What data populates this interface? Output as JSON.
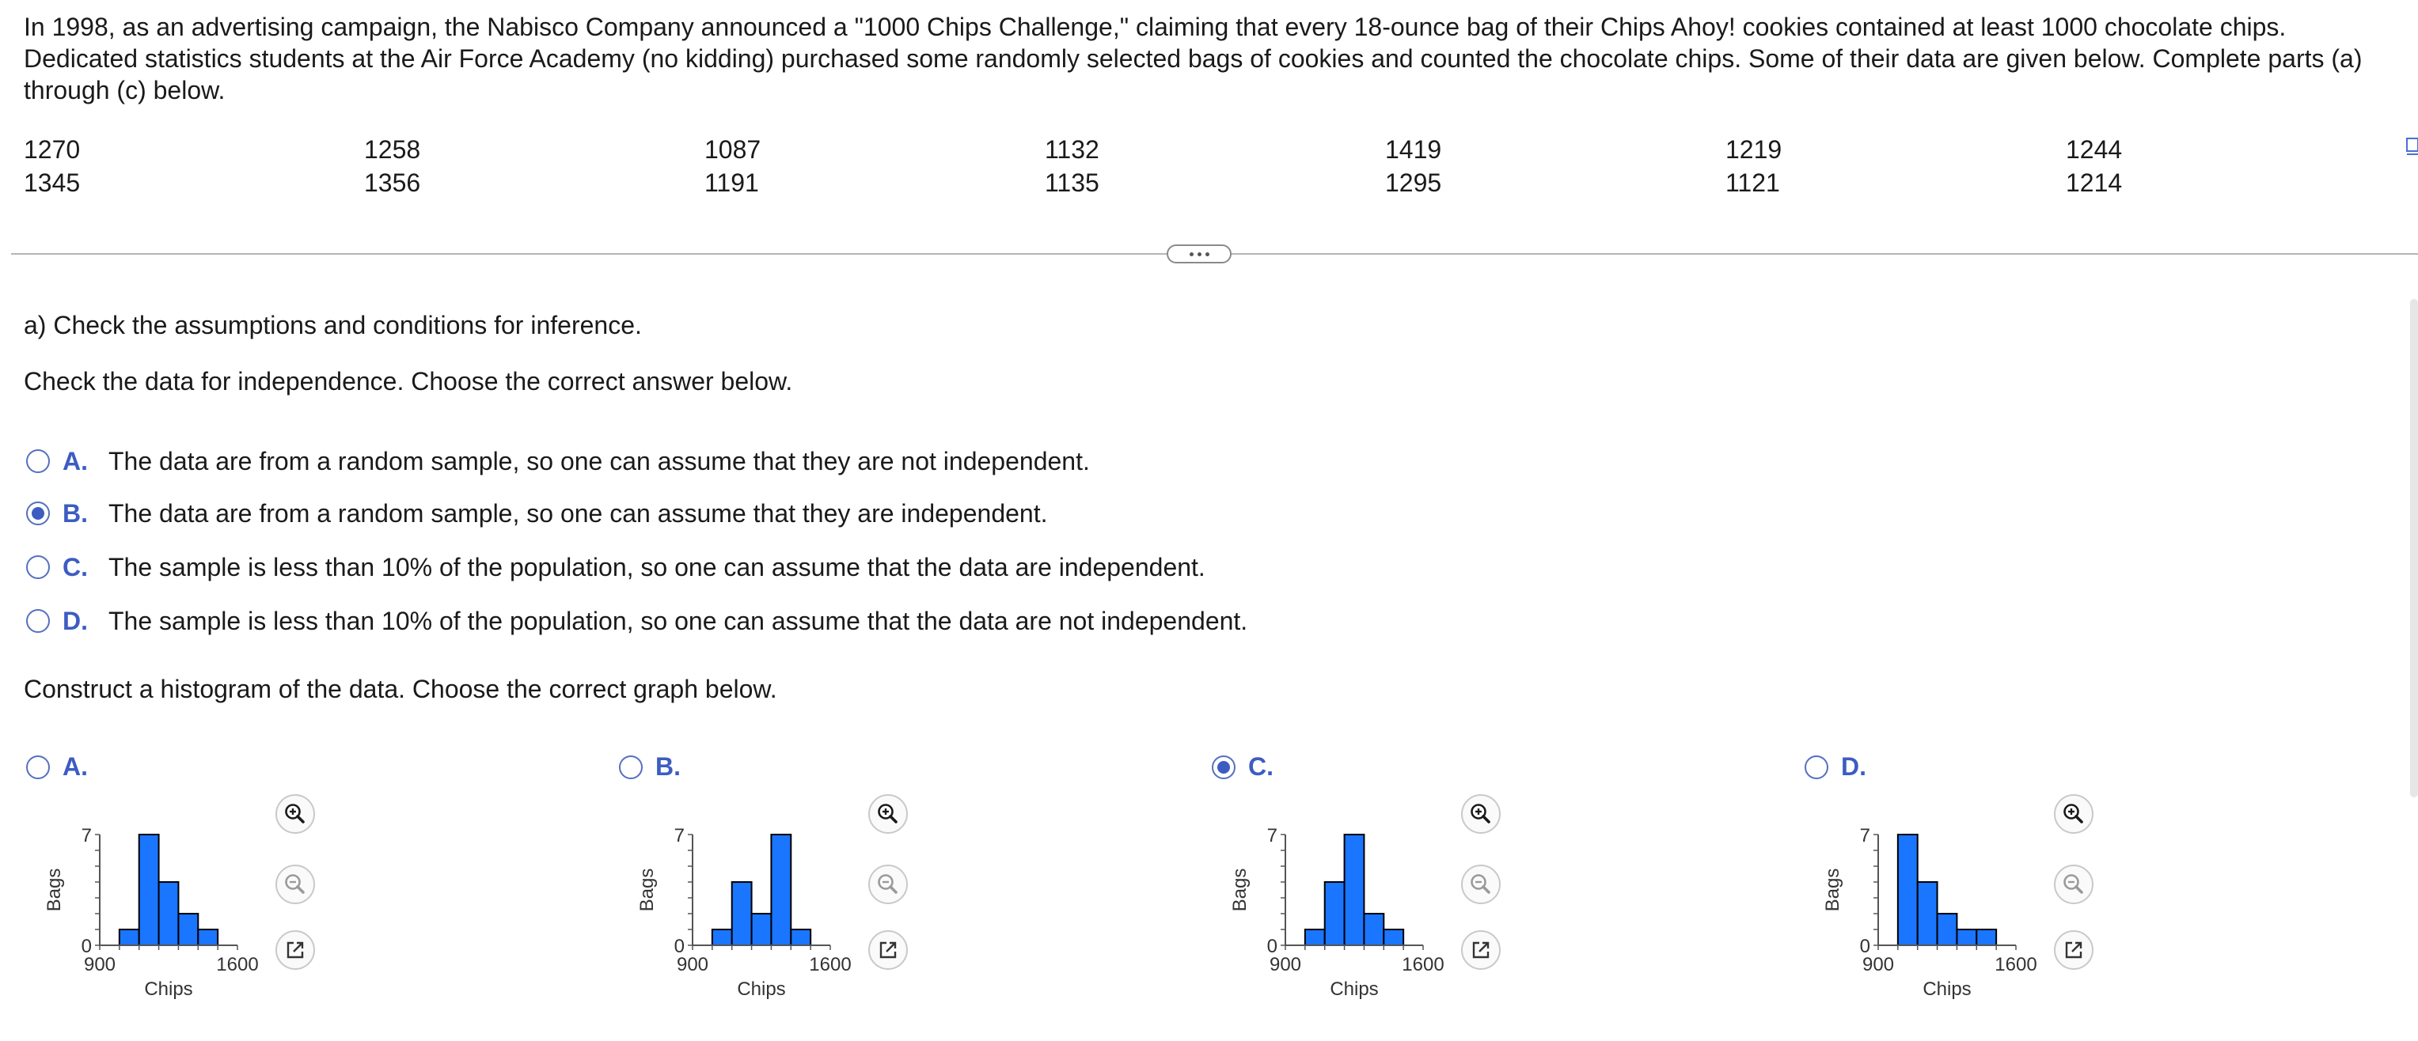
{
  "intro": "In 1998, as an advertising campaign, the Nabisco Company announced a \"1000 Chips Challenge,\" claiming that every 18-ounce bag of their Chips Ahoy! cookies contained at least 1000 chocolate chips. Dedicated statistics students at the Air Force Academy (no kidding) purchased some randomly selected bags of cookies and counted the chocolate chips. Some of their data are given below. Complete parts (a) through (c) below.",
  "data_values": [
    [
      "1270",
      "1258",
      "1087",
      "1132",
      "1419",
      "1219",
      "1244"
    ],
    [
      "1345",
      "1356",
      "1191",
      "1135",
      "1295",
      "1121",
      "1214"
    ]
  ],
  "part_a": {
    "heading": "a) Check the assumptions and conditions for inference.",
    "independence_prompt": "Check the data for independence. Choose the correct answer below.",
    "options": [
      {
        "letter": "A.",
        "text": "The data are from a random sample, so one can assume that they are not independent.",
        "selected": false
      },
      {
        "letter": "B.",
        "text": "The data are from a random sample, so one can assume that they are independent.",
        "selected": true
      },
      {
        "letter": "C.",
        "text": "The sample is less than 10% of the population, so one can assume that the data are independent.",
        "selected": false
      },
      {
        "letter": "D.",
        "text": "The sample is less than 10% of the population, so one can assume that the data are not independent.",
        "selected": false
      }
    ],
    "histogram_prompt": "Construct a histogram of the data. Choose the correct graph below."
  },
  "colors": {
    "accent": "#3d5cc2",
    "bar_fill": "#1a75ff",
    "bar_stroke": "#000000"
  },
  "chart_data": [
    {
      "type": "bar",
      "option": "A.",
      "selected": false,
      "xlabel": "Chips",
      "ylabel": "Bags",
      "xlim": [
        900,
        1600
      ],
      "ylim": [
        0,
        7
      ],
      "x_ticks": [
        "900",
        "1600"
      ],
      "y_ticks": [
        "0",
        "7"
      ],
      "bin_edges": [
        1000,
        1100,
        1200,
        1300,
        1400,
        1500
      ],
      "values": [
        1,
        7,
        4,
        2,
        1
      ]
    },
    {
      "type": "bar",
      "option": "B.",
      "selected": false,
      "xlabel": "Chips",
      "ylabel": "Bags",
      "xlim": [
        900,
        1600
      ],
      "ylim": [
        0,
        7
      ],
      "x_ticks": [
        "900",
        "1600"
      ],
      "y_ticks": [
        "0",
        "7"
      ],
      "bin_edges": [
        1000,
        1100,
        1200,
        1300,
        1400,
        1500
      ],
      "values": [
        1,
        4,
        2,
        7,
        1
      ]
    },
    {
      "type": "bar",
      "option": "C.",
      "selected": true,
      "xlabel": "Chips",
      "ylabel": "Bags",
      "xlim": [
        900,
        1600
      ],
      "ylim": [
        0,
        7
      ],
      "x_ticks": [
        "900",
        "1600"
      ],
      "y_ticks": [
        "0",
        "7"
      ],
      "bin_edges": [
        1000,
        1100,
        1200,
        1300,
        1400,
        1500
      ],
      "values": [
        1,
        4,
        7,
        2,
        1
      ]
    },
    {
      "type": "bar",
      "option": "D.",
      "selected": false,
      "xlabel": "Chips",
      "ylabel": "Bags",
      "xlim": [
        900,
        1600
      ],
      "ylim": [
        0,
        7
      ],
      "x_ticks": [
        "900",
        "1600"
      ],
      "y_ticks": [
        "0",
        "7"
      ],
      "bin_edges": [
        1000,
        1100,
        1200,
        1300,
        1400,
        1500
      ],
      "values": [
        7,
        4,
        2,
        1,
        1
      ]
    }
  ],
  "icons": {
    "zoom_in": "zoom-in-icon",
    "zoom_out": "zoom-out-icon",
    "open_window": "open-in-new-window-icon",
    "expand": "more-dots-icon"
  }
}
